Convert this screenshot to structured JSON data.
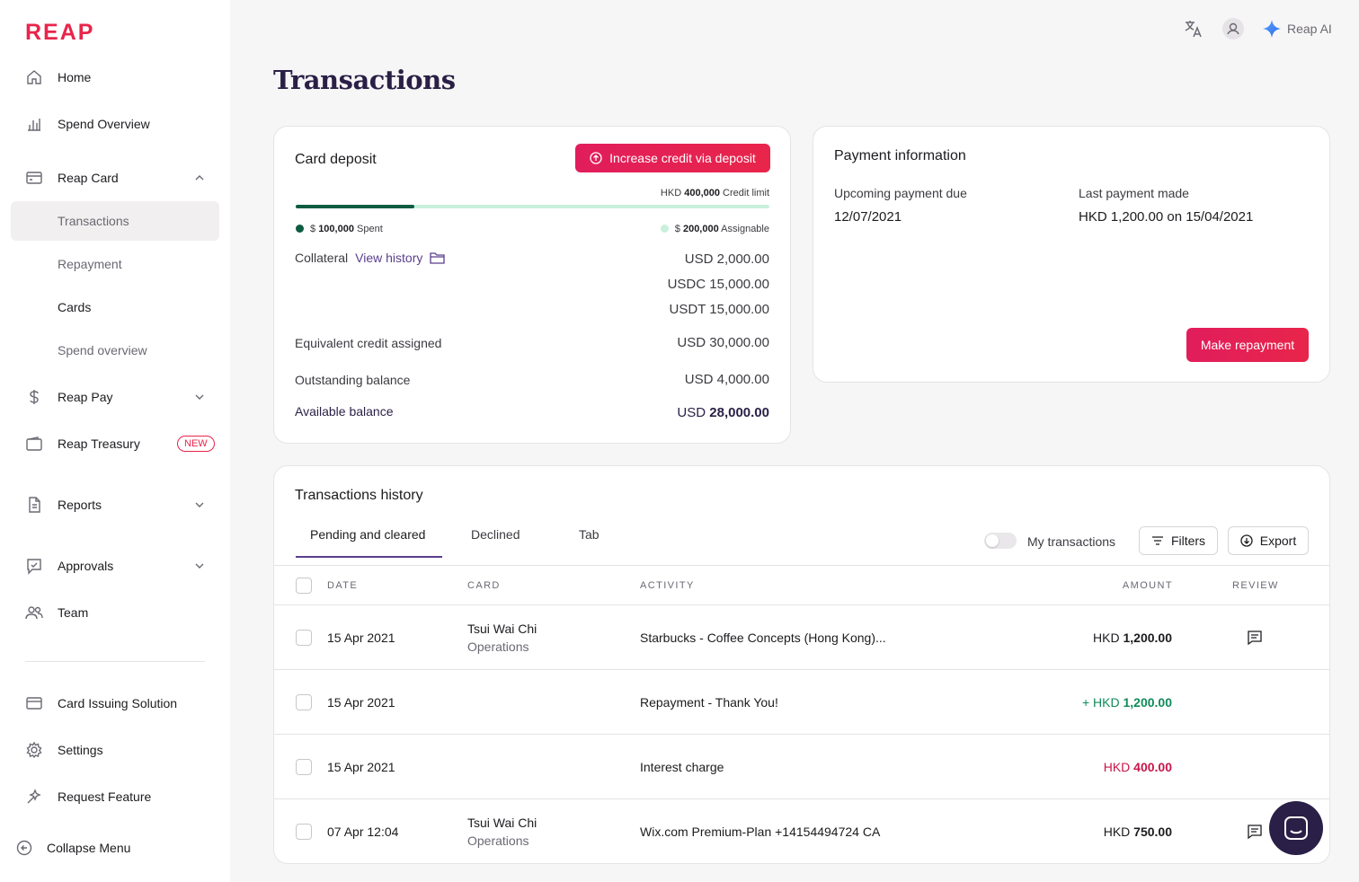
{
  "brand": {
    "logo_text": "REAP",
    "accent": "#e8254a",
    "primary_dark": "#2a1f46"
  },
  "sidebar": {
    "items": [
      {
        "label": "Home",
        "icon": "home-icon"
      },
      {
        "label": "Spend Overview",
        "icon": "bar-chart-icon"
      },
      {
        "label": "Reap Card",
        "icon": "card-icon",
        "expanded": true
      },
      {
        "label": "Reap Pay",
        "icon": "dollar-icon"
      },
      {
        "label": "Reap Treasury",
        "icon": "wallet-icon",
        "badge": "NEW"
      },
      {
        "label": "Reports",
        "icon": "document-icon"
      },
      {
        "label": "Approvals",
        "icon": "approval-icon"
      },
      {
        "label": "Team",
        "icon": "team-icon"
      }
    ],
    "sub_items": [
      {
        "label": "Transactions",
        "active": true
      },
      {
        "label": "Repayment"
      },
      {
        "label": "Cards"
      },
      {
        "label": "Spend overview"
      }
    ],
    "bottom_items": [
      {
        "label": "Card Issuing Solution",
        "icon": "card-stack-icon"
      },
      {
        "label": "Settings",
        "icon": "gear-icon"
      },
      {
        "label": "Request Feature",
        "icon": "sparkle-icon"
      }
    ],
    "collapse_label": "Collapse Menu"
  },
  "topbar": {
    "ai_label": "Reap AI"
  },
  "page": {
    "title": "Transactions"
  },
  "card_deposit": {
    "title": "Card deposit",
    "cta": "Increase credit via deposit",
    "credit_limit_prefix": "HKD",
    "credit_limit_value": "400,000",
    "credit_limit_suffix": "Credit limit",
    "spent_fraction": 0.25,
    "spent_prefix": "$",
    "spent_value": "100,000",
    "spent_suffix": "Spent",
    "assignable_prefix": "$",
    "assignable_value": "200,000",
    "assignable_suffix": "Assignable",
    "collateral_label": "Collateral",
    "view_history": "View history",
    "collateral_values": [
      "USD 2,000.00",
      "USDC 15,000.00",
      "USDT 15,000.00"
    ],
    "equivalent_label": "Equivalent credit assigned",
    "equivalent_value": "USD 30,000.00",
    "outstanding_label": "Outstanding balance",
    "outstanding_value": "USD 4,000.00",
    "available_label": "Available balance",
    "available_prefix": "USD",
    "available_value": "28,000.00"
  },
  "payment_info": {
    "title": "Payment information",
    "upcoming_label": "Upcoming payment due",
    "upcoming_value": "12/07/2021",
    "last_label": "Last payment made",
    "last_value": "HKD 1,200.00 on 15/04/2021",
    "cta": "Make repayment"
  },
  "history": {
    "title": "Transactions history",
    "tabs": [
      "Pending and cleared",
      "Declined",
      "Tab"
    ],
    "my_transactions": "My transactions",
    "filters": "Filters",
    "export": "Export",
    "columns": [
      "DATE",
      "CARD",
      "ACTIVITY",
      "AMOUNT",
      "REVIEW"
    ],
    "rows": [
      {
        "date": "15 Apr 2021",
        "card_name": "Tsui Wai Chi",
        "card_team": "Operations",
        "activity": "Starbucks - Coffee Concepts (Hong Kong)...",
        "amount_prefix": "HKD",
        "amount_value": "1,200.00",
        "review": true
      },
      {
        "date": "15 Apr 2021",
        "card_name": "",
        "card_team": "",
        "activity": "Repayment - Thank You!",
        "amount_prefix": "+ HKD",
        "amount_value": "1,200.00",
        "review": false
      },
      {
        "date": "15 Apr 2021",
        "card_name": "",
        "card_team": "",
        "activity": "Interest charge",
        "amount_prefix": "HKD",
        "amount_value": "400.00",
        "review": false
      },
      {
        "date": "07 Apr 12:04",
        "card_name": "Tsui Wai Chi",
        "card_team": "Operations",
        "activity": "Wix.com Premium-Plan +14154494724 CA",
        "amount_prefix": "HKD",
        "amount_value": "750.00",
        "review": true
      }
    ]
  }
}
